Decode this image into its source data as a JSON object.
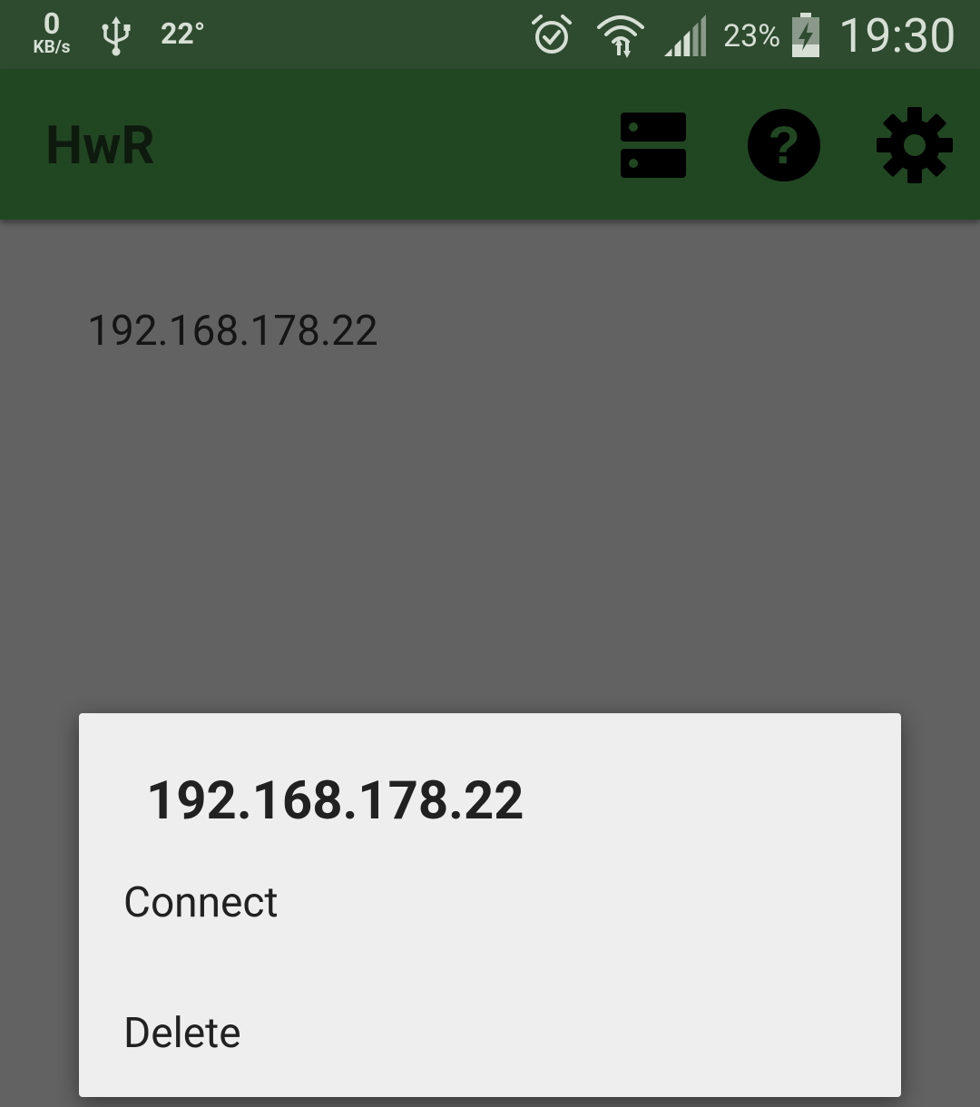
{
  "status_bar": {
    "net_speed_value": "0",
    "net_speed_unit": "KB/s",
    "temperature": "22°",
    "battery_percent": "23%",
    "time": "19:30",
    "icons": [
      "usb-icon",
      "alarm-icon",
      "wifi-icon",
      "cell-signal-icon",
      "battery-charging-icon"
    ]
  },
  "app_bar": {
    "title": "HwR",
    "actions": [
      "servers-icon",
      "help-icon",
      "settings-icon"
    ],
    "color": "#214722"
  },
  "content": {
    "servers": [
      "192.168.178.22"
    ]
  },
  "dialog": {
    "title": "192.168.178.22",
    "items": [
      {
        "label": "Connect"
      },
      {
        "label": "Delete"
      }
    ]
  }
}
